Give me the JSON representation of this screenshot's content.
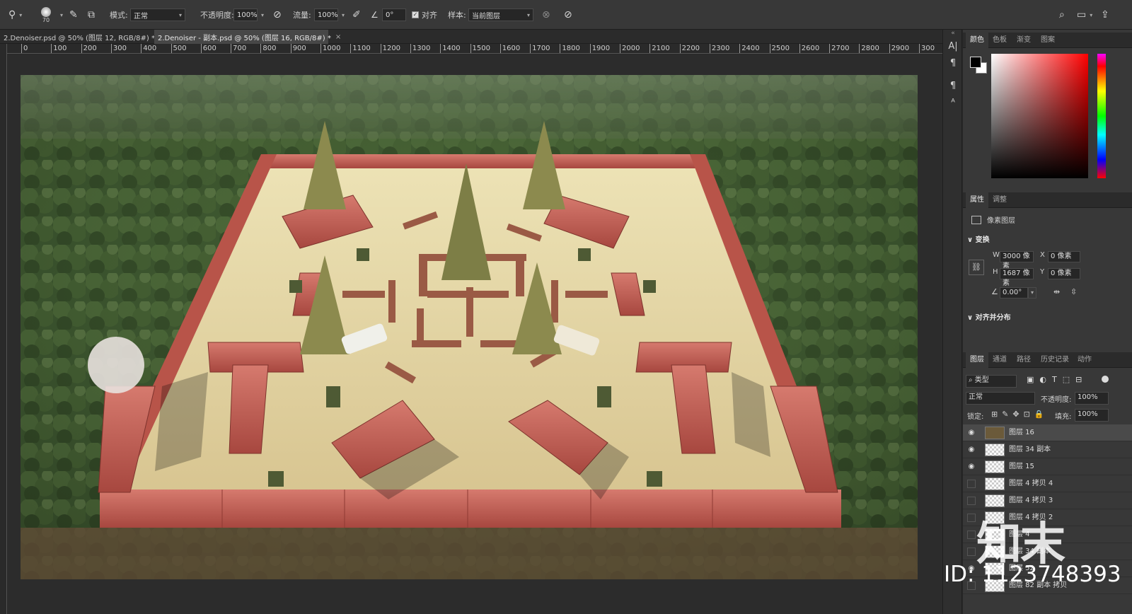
{
  "options_bar": {
    "brush_size": "70",
    "mode_label": "模式:",
    "mode_value": "正常",
    "opacity_label": "不透明度:",
    "opacity_value": "100%",
    "flow_label": "流量:",
    "flow_value": "100%",
    "angle_value": "0°",
    "align_label": "对齐",
    "sample_label": "样本:",
    "sample_value": "当前图层"
  },
  "tabs": [
    {
      "label": "2.Denoiser.psd @ 50% (图层 12, RGB/8#) *",
      "active": false
    },
    {
      "label": "2.Denoiser - 副本.psd @ 50% (图层 16, RGB/8#) *",
      "active": true
    }
  ],
  "ruler": {
    "ticks": [
      "0",
      "100",
      "200",
      "300",
      "400",
      "500",
      "600",
      "700",
      "800",
      "900",
      "1000",
      "1100",
      "1200",
      "1300",
      "1400",
      "1500",
      "1600",
      "1700",
      "1800",
      "1900",
      "2000",
      "2100",
      "2200",
      "2300",
      "2400",
      "2500",
      "2600",
      "2700",
      "2800",
      "2900",
      "300"
    ]
  },
  "color_panel": {
    "tabs": [
      "颜色",
      "色板",
      "渐变",
      "图案"
    ],
    "hue_color": "#ff0000"
  },
  "properties_panel": {
    "tabs": [
      "属性",
      "调整"
    ],
    "layer_type": "像素图层",
    "transform_title": "变换",
    "w_label": "W",
    "w_value": "3000 像素",
    "h_label": "H",
    "h_value": "1687 像素",
    "x_label": "X",
    "x_value": "0 像素",
    "y_label": "Y",
    "y_value": "0 像素",
    "angle_value": "0.00°",
    "align_title": "对齐并分布"
  },
  "layers_panel": {
    "tabs": [
      "图层",
      "通道",
      "路径",
      "历史记录",
      "动作"
    ],
    "filter_value": "类型",
    "blend_value": "正常",
    "opacity_label": "不透明度:",
    "opacity_value": "100%",
    "lock_label": "锁定:",
    "fill_label": "填充:",
    "fill_value": "100%",
    "layers": [
      {
        "name": "图层 16",
        "visible": true,
        "selected": true
      },
      {
        "name": "图层 34 副本",
        "visible": true,
        "selected": false
      },
      {
        "name": "图层 15",
        "visible": true,
        "selected": false
      },
      {
        "name": "图层 4 拷贝 4",
        "visible": false,
        "selected": false
      },
      {
        "name": "图层 4 拷贝 3",
        "visible": false,
        "selected": false
      },
      {
        "name": "图层 4 拷贝 2",
        "visible": false,
        "selected": false
      },
      {
        "name": "图层 4",
        "visible": false,
        "selected": false
      },
      {
        "name": "图层 34 副本",
        "visible": false,
        "selected": false
      },
      {
        "name": "图层 52",
        "visible": true,
        "selected": false
      },
      {
        "name": "图层 82 副本 拷贝",
        "visible": false,
        "selected": false
      }
    ]
  },
  "watermark": {
    "logo": "知末",
    "id": "ID: 1123748393"
  }
}
